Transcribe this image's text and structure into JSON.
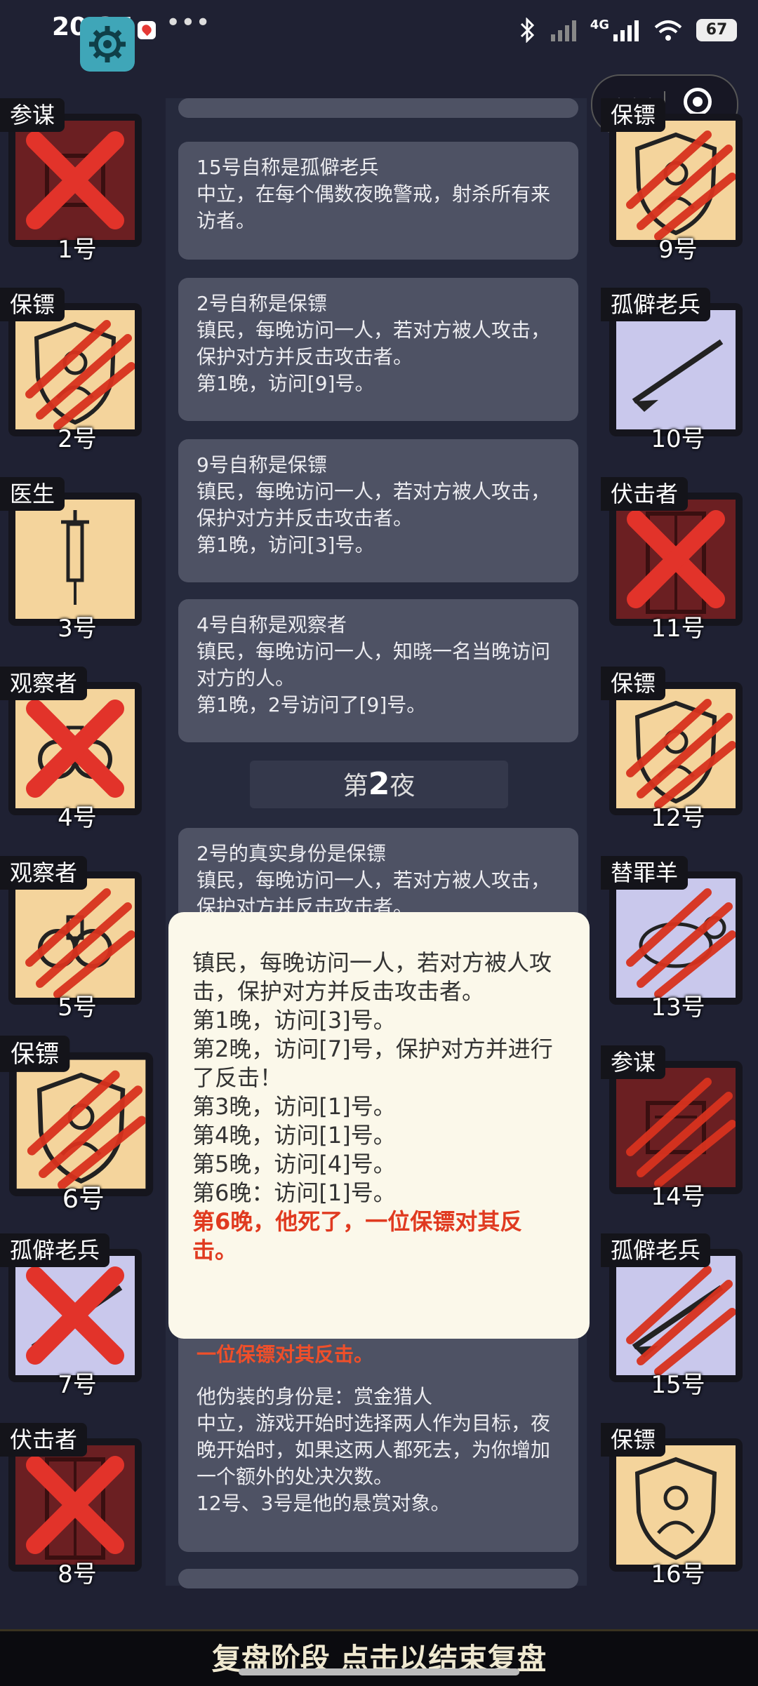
{
  "status_bar": {
    "time": "20:37",
    "more": "•••",
    "battery": "67",
    "network": "4G"
  },
  "capsule": {
    "more_label": "•••"
  },
  "cards": [
    {
      "lines": [
        "15号自称是孤僻老兵",
        "中立，在每个偶数夜晚警戒，射杀所有来访者。"
      ]
    },
    {
      "lines": [
        "2号自称是保镖",
        "镇民，每晚访问一人，若对方被人攻击，保护对方并反击攻击者。",
        "第1晚，访问[9]号。"
      ]
    },
    {
      "lines": [
        "9号自称是保镖",
        "镇民，每晚访问一人，若对方被人攻击，保护对方并反击攻击者。",
        "第1晚，访问[3]号。"
      ]
    },
    {
      "lines": [
        "4号自称是观察者",
        "镇民，每晚访问一人，知晓一名当晚访问对方的人。",
        "第1晚，2号访问了[9]号。"
      ]
    },
    {
      "lines": [
        "2号的真实身份是保镖",
        "镇民，每晚访问一人，若对方被人攻击，保护对方并反击攻击者。"
      ]
    },
    {
      "lines": [
        "一位保镖对其反击。",
        "",
        "他伪装的身份是：赏金猎人",
        "中立，游戏开始时选择两人作为目标，夜晚开始时，如果这两人都死去，为你增加一个额外的处决次数。",
        "12号、3号是他的悬赏对象。"
      ]
    }
  ],
  "night_marker": {
    "prefix": "第",
    "number": "2",
    "suffix": "夜"
  },
  "popup": {
    "lines": [
      "镇民，每晚访问一人，若对方被人攻击，保护对方并反击攻击者。",
      "第1晚，访问[3]号。",
      "第2晚，访问[7]号，保护对方并进行了反击！",
      "第3晚，访问[1]号。",
      "第4晚，访问[1]号。",
      "第5晚，访问[4]号。",
      "第6晚：访问[1]号。"
    ],
    "death": "第6晚，他死了，一位保镖对其反击。"
  },
  "players": {
    "p1": {
      "role": "参谋",
      "num": "1号",
      "state": "x"
    },
    "p2": {
      "role": "保镖",
      "num": "2号",
      "state": "claw"
    },
    "p3": {
      "role": "医生",
      "num": "3号",
      "state": "alive"
    },
    "p4": {
      "role": "观察者",
      "num": "4号",
      "state": "x"
    },
    "p5": {
      "role": "观察者",
      "num": "5号",
      "state": "claw"
    },
    "p6": {
      "role": "保镖",
      "num": "6号",
      "state": "claw"
    },
    "p7": {
      "role": "孤僻老兵",
      "num": "7号",
      "state": "x"
    },
    "p8": {
      "role": "伏击者",
      "num": "8号",
      "state": "x"
    },
    "p9": {
      "role": "保镖",
      "num": "9号",
      "state": "claw"
    },
    "p10": {
      "role": "孤僻老兵",
      "num": "10号",
      "state": "alive"
    },
    "p11": {
      "role": "伏击者",
      "num": "11号",
      "state": "x"
    },
    "p12": {
      "role": "保镖",
      "num": "12号",
      "state": "claw"
    },
    "p13": {
      "role": "替罪羊",
      "num": "13号",
      "state": "claw"
    },
    "p14": {
      "role": "参谋",
      "num": "14号",
      "state": "claw"
    },
    "p15": {
      "role": "孤僻老兵",
      "num": "15号",
      "state": "claw"
    },
    "p16": {
      "role": "保镖",
      "num": "16号",
      "state": "alive"
    }
  },
  "bottom_bar": {
    "label": "复盘阶段 点击以结束复盘"
  },
  "colors": {
    "accent_red": "#e03a20",
    "tan": "#f4d49c",
    "lavender": "#c9c8ec",
    "dark_red": "#6b1f22"
  }
}
